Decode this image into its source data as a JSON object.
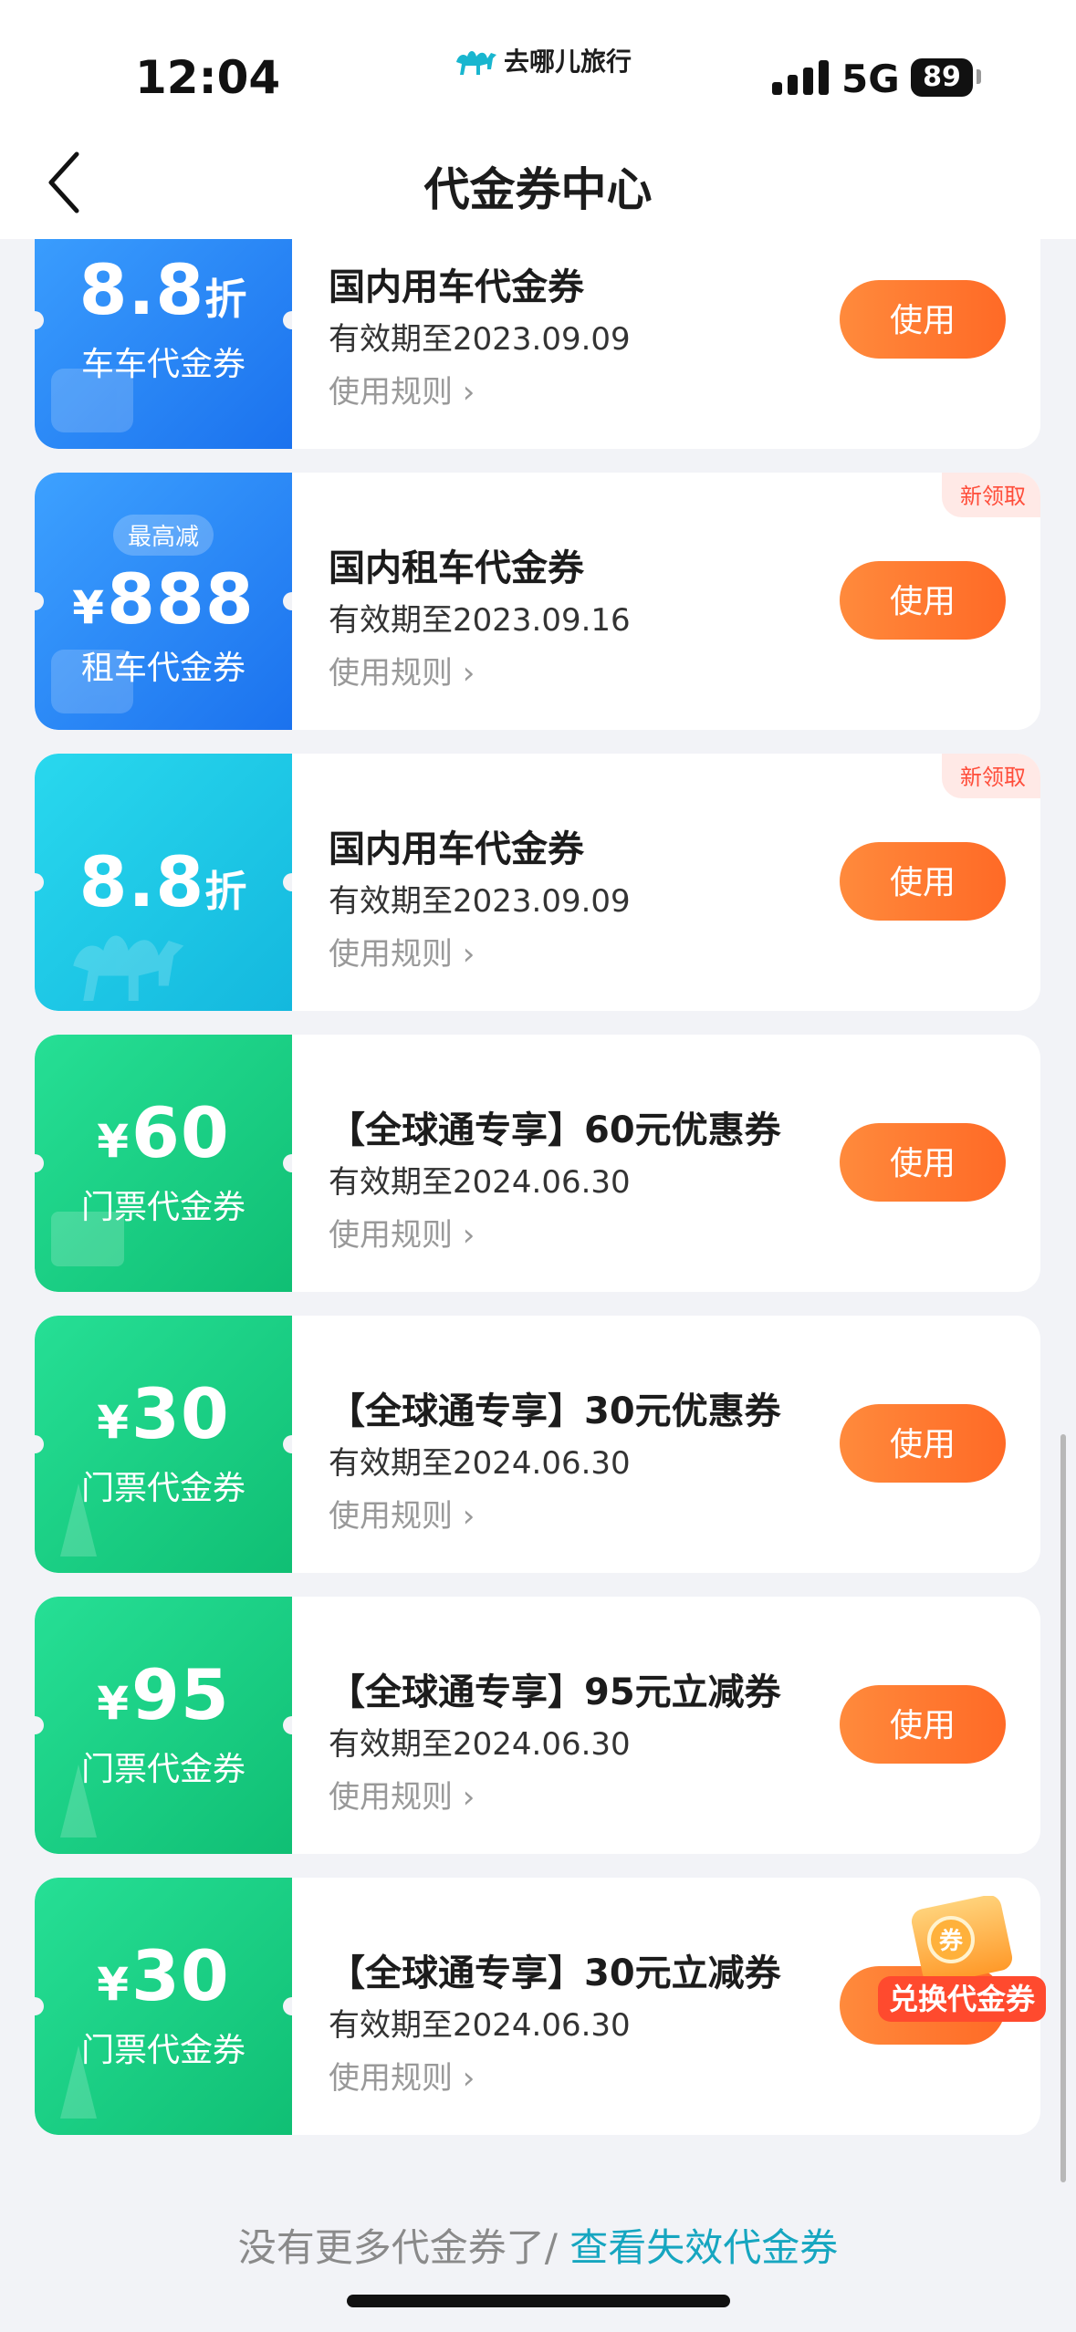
{
  "status": {
    "time": "12:04",
    "network": "5G",
    "battery": "89"
  },
  "app": {
    "name": "去哪儿旅行"
  },
  "header": {
    "title": "代金券中心"
  },
  "coupons": [
    {
      "stub_color": "blue",
      "pill": "",
      "amount": "8.8",
      "unit": "折",
      "currency": "",
      "stub_label": "车车代金券",
      "title": "国内用车代金券",
      "validity": "有效期至2023.09.09",
      "rules": "使用规则 ›",
      "action": "使用",
      "badge": ""
    },
    {
      "stub_color": "blue",
      "pill": "最高减",
      "amount": "888",
      "unit": "",
      "currency": "¥",
      "stub_label": "租车代金券",
      "title": "国内租车代金券",
      "validity": "有效期至2023.09.16",
      "rules": "使用规则 ›",
      "action": "使用",
      "badge": "新领取"
    },
    {
      "stub_color": "cyan",
      "pill": "",
      "amount": "8.8",
      "unit": "折",
      "currency": "",
      "stub_label": "",
      "title": "国内用车代金券",
      "validity": "有效期至2023.09.09",
      "rules": "使用规则 ›",
      "action": "使用",
      "badge": "新领取"
    },
    {
      "stub_color": "green",
      "pill": "",
      "amount": "60",
      "unit": "",
      "currency": "¥",
      "stub_label": "门票代金券",
      "title": "【全球通专享】60元优惠券",
      "validity": "有效期至2024.06.30",
      "rules": "使用规则 ›",
      "action": "使用",
      "badge": ""
    },
    {
      "stub_color": "green",
      "pill": "",
      "amount": "30",
      "unit": "",
      "currency": "¥",
      "stub_label": "门票代金券",
      "title": "【全球通专享】30元优惠券",
      "validity": "有效期至2024.06.30",
      "rules": "使用规则 ›",
      "action": "使用",
      "badge": ""
    },
    {
      "stub_color": "green",
      "pill": "",
      "amount": "95",
      "unit": "",
      "currency": "¥",
      "stub_label": "门票代金券",
      "title": "【全球通专享】95元立减券",
      "validity": "有效期至2024.06.30",
      "rules": "使用规则 ›",
      "action": "使用",
      "badge": ""
    },
    {
      "stub_color": "green",
      "pill": "",
      "amount": "30",
      "unit": "",
      "currency": "¥",
      "stub_label": "门票代金券",
      "title": "【全球通专享】30元立减券",
      "validity": "有效期至2024.06.30",
      "rules": "使用规则 ›",
      "action": "使用",
      "badge": ""
    }
  ],
  "floating": {
    "redeem_label": "兑换代金券",
    "redeem_icon_text": "券"
  },
  "footer": {
    "no_more": "没有更多代金券了/ ",
    "view_expired": "查看失效代金券"
  },
  "colors": {
    "accent_orange": "#ff6a26",
    "link_teal": "#16a6c0",
    "badge_red": "#ff4d3a"
  }
}
